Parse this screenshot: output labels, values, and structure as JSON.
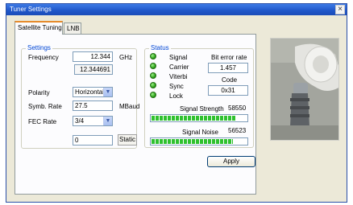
{
  "window": {
    "title": "Tuner Settings",
    "close_label": "×"
  },
  "tabs": [
    {
      "label": "Satellite Tuning"
    },
    {
      "label": "LNB"
    }
  ],
  "settings": {
    "group_title": "Settings",
    "frequency_label": "Frequency",
    "frequency_value": "12.344",
    "frequency_unit": "GHz",
    "frequency_readout": "12.344691",
    "polarity_label": "Polarity",
    "polarity_value": "Horizontal",
    "symbol_rate_label": "Symb. Rate",
    "symbol_rate_value": "27.5",
    "symbol_rate_unit": "MBaud",
    "fec_rate_label": "FEC Rate",
    "fec_rate_value": "3/4",
    "extra_value": "0",
    "static_label": "Static"
  },
  "status": {
    "group_title": "Status",
    "indicators": [
      {
        "label": "Signal"
      },
      {
        "label": "Carrier"
      },
      {
        "label": "Viterbi"
      },
      {
        "label": "Sync"
      },
      {
        "label": "Lock"
      }
    ],
    "bit_error_rate_label": "Bit error rate",
    "bit_error_rate_value": "1.457",
    "code_label": "Code",
    "code_value": "0x31",
    "signal_strength_label": "Signal Strength",
    "signal_strength_value": "58550",
    "signal_strength_level": 0.89,
    "signal_noise_label": "Signal Noise",
    "signal_noise_value": "56523",
    "signal_noise_level": 0.86
  },
  "actions": {
    "apply_label": "Apply"
  },
  "colors": {
    "group_title": "#0046d5",
    "led_on": "#2fa51a",
    "meter_fill": "#2fc12f",
    "titlebar": "#1f56c8"
  }
}
